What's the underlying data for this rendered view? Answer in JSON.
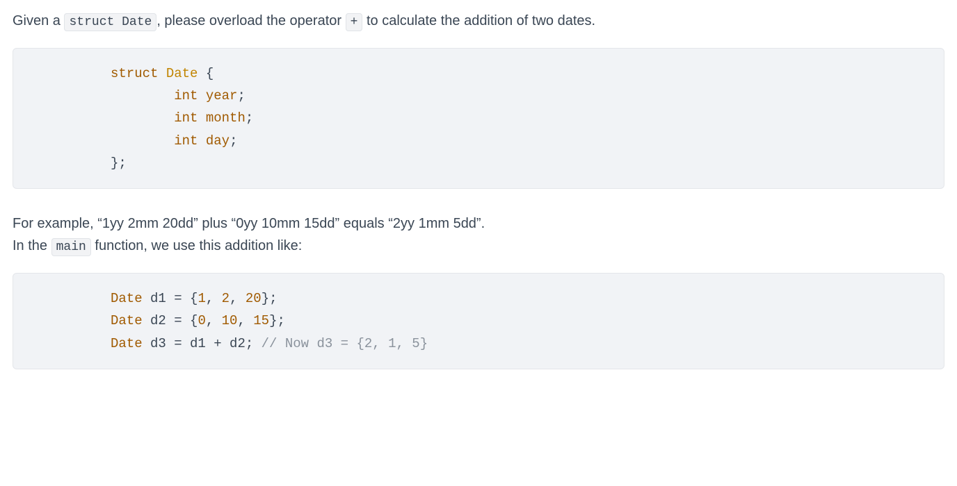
{
  "intro": {
    "pre": "Given a ",
    "code1": "struct Date",
    "mid": ", please overload the operator ",
    "code2": "+",
    "post": " to calculate the addition of two dates."
  },
  "code1": {
    "kw_struct": "struct",
    "name": "Date",
    "open": " {",
    "field_kw": "int",
    "f1": "year",
    "f2": "month",
    "f3": "day",
    "semi": ";",
    "close": "};"
  },
  "para2": {
    "line1": "For example, “1yy 2mm 20dd” plus “0yy 10mm 15dd” equals “2yy 1mm 5dd”.",
    "line2_pre": "In the ",
    "line2_code": "main",
    "line2_post": " function, we use this addition like:"
  },
  "code2": {
    "d1_type": "Date",
    "d1_name": " d1 ",
    "eq": "=",
    "d1_vals": {
      "a": "1",
      "b": "2",
      "c": "20"
    },
    "d2_type": "Date",
    "d2_name": " d2 ",
    "d2_vals": {
      "a": "0",
      "b": "10",
      "c": "15"
    },
    "d3_type": "Date",
    "d3_name": " d3 ",
    "d3_expr": " d1 + d2; ",
    "comment": "// Now d3 = {2, 1, 5}",
    "open": " {",
    "close": "};",
    "comma": ", "
  }
}
